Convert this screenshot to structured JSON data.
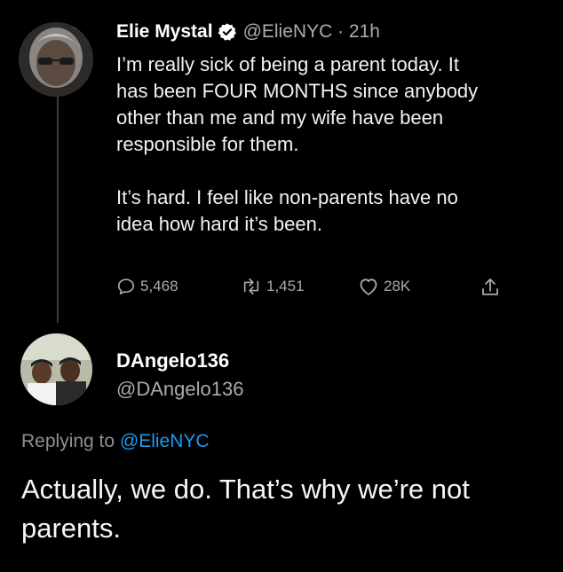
{
  "tweet": {
    "author_name": "Elie Mystal",
    "handle_time": "@ElieNYC · 21h",
    "lines_p1": [
      "I’m really sick of being a parent today. It",
      "has been FOUR MONTHS since anybody",
      "other than me and my wife have been",
      "responsible for them."
    ],
    "lines_p2": [
      "It’s hard. I feel like non-parents have no",
      "idea how hard it’s been."
    ],
    "replies": "5,468",
    "retweets": "1,451",
    "likes": "28K"
  },
  "reply": {
    "author_name": "DAngelo136",
    "handle": "@DAngelo136",
    "replying_prefix": "Replying to",
    "replying_mention": "@ElieNYC",
    "text": "Actually, we do. That’s why we’re not parents."
  },
  "colors": {
    "background": "#000000",
    "text": "#e7e9ea",
    "muted": "#a7acb1",
    "link": "#1d9bf0"
  }
}
